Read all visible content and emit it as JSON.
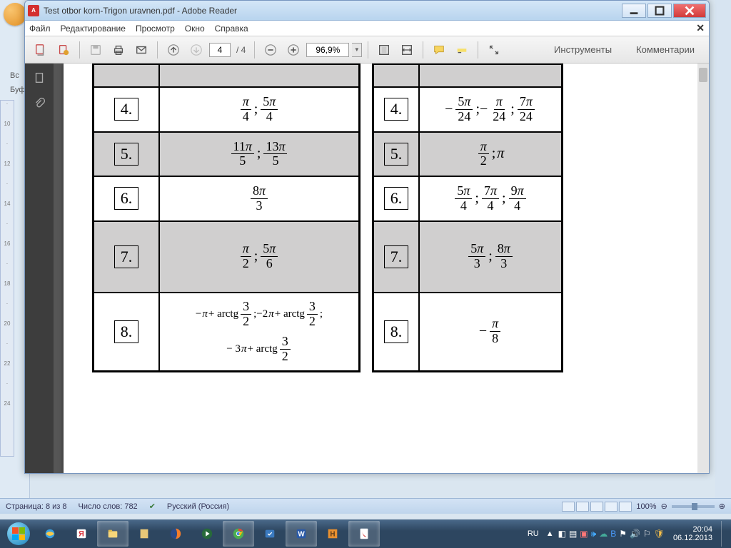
{
  "acrobat": {
    "title": "Test otbor korn-Trigon uravnen.pdf - Adobe Reader",
    "menu": {
      "file": "Файл",
      "edit": "Редактирование",
      "view": "Просмотр",
      "window": "Окно",
      "help": "Справка"
    },
    "toolbar": {
      "page": "4",
      "page_total": "/ 4",
      "zoom": "96,9%",
      "tools": "Инструменты",
      "comments": "Комментарии"
    }
  },
  "table_left": [
    {
      "n": "4.",
      "math": "π/4 ; 5π/4",
      "alt": false
    },
    {
      "n": "5.",
      "math": "11π/5 ; 13π/5",
      "alt": true
    },
    {
      "n": "6.",
      "math": "8π/3",
      "alt": false
    },
    {
      "n": "7.",
      "math": "π/2 ; 5π/6",
      "alt": true
    },
    {
      "n": "8.",
      "math": "−π+arctg 3/2 ; −2π+arctg 3/2 ; −3π+arctg 3/2",
      "alt": false
    }
  ],
  "table_right": [
    {
      "n": "4.",
      "math": "−5π/24 ; −π/24 ; 7π/24",
      "alt": false
    },
    {
      "n": "5.",
      "math": "π/2 ; π",
      "alt": true
    },
    {
      "n": "6.",
      "math": "5π/4 ; 7π/4 ; 9π/4",
      "alt": false
    },
    {
      "n": "7.",
      "math": "5π/3 ; 8π/3",
      "alt": true
    },
    {
      "n": "8.",
      "math": "−π/8",
      "alt": false
    }
  ],
  "word": {
    "tab1": "Вс",
    "tab2": "Буфе",
    "status_page": "Страница: 8 из 8",
    "status_words": "Число слов: 782",
    "status_lang": "Русский (Россия)",
    "status_zoom": "100%"
  },
  "taskbar": {
    "lang": "RU",
    "time": "20:04",
    "date": "06.12.2013"
  }
}
